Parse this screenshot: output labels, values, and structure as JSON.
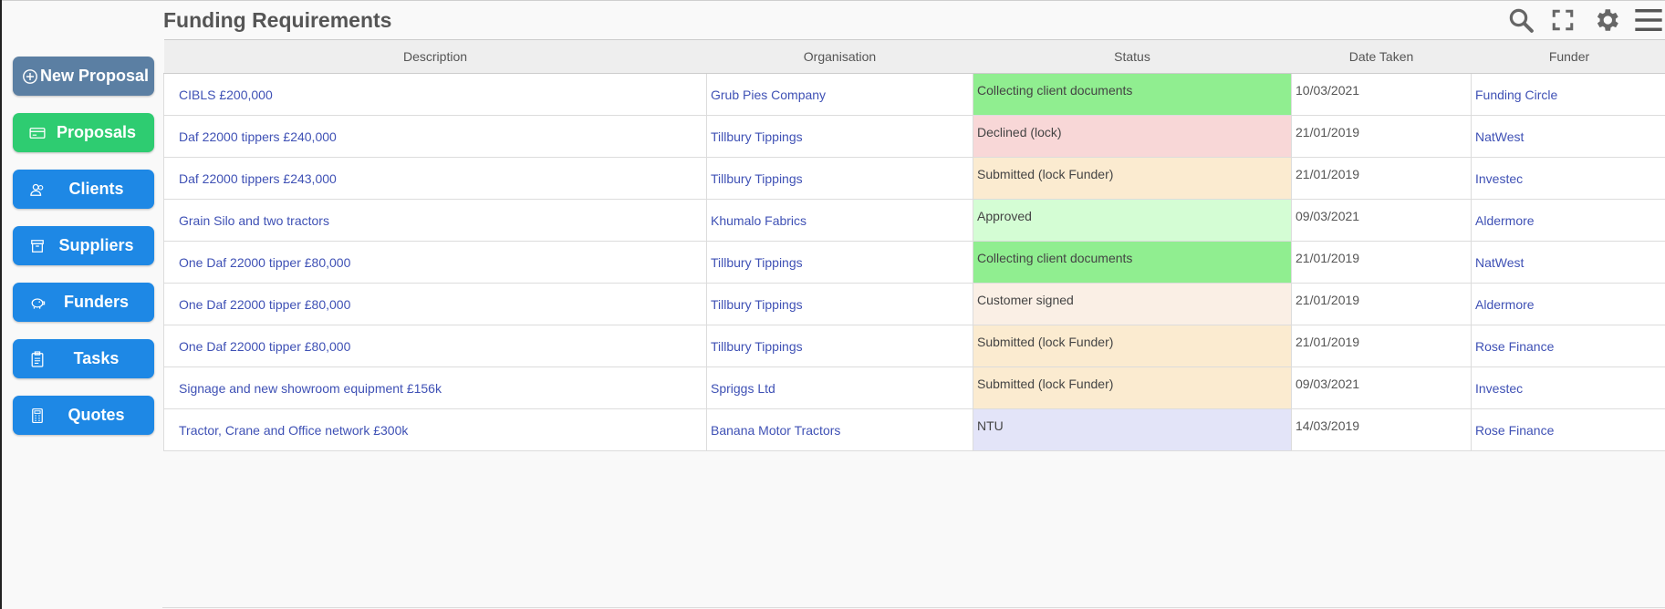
{
  "header": {
    "title": "Funding Requirements"
  },
  "toolbar": {
    "icons": [
      "search-icon",
      "fullscreen-icon",
      "gear-icon",
      "menu-icon"
    ]
  },
  "sidebar": {
    "items": [
      {
        "label": "New Proposal",
        "icon": "plus-circle-icon"
      },
      {
        "label": "Proposals",
        "icon": "card-icon"
      },
      {
        "label": "Clients",
        "icon": "users-icon"
      },
      {
        "label": "Suppliers",
        "icon": "box-icon"
      },
      {
        "label": "Funders",
        "icon": "piggy-bank-icon"
      },
      {
        "label": "Tasks",
        "icon": "clipboard-icon"
      },
      {
        "label": "Quotes",
        "icon": "calculator-icon"
      }
    ]
  },
  "table": {
    "columns": [
      "Description",
      "Organisation",
      "Status",
      "Date Taken",
      "Funder"
    ],
    "rows": [
      {
        "description": "CIBLS £200,000",
        "organisation": "Grub Pies Company",
        "status": "Collecting client documents",
        "status_color": "#90ee90",
        "date": "10/03/2021",
        "funder": "Funding Circle"
      },
      {
        "description": "Daf 22000 tippers £240,000",
        "organisation": "Tillbury Tippings",
        "status": "Declined (lock)",
        "status_color": "#f8d7d7",
        "date": "21/01/2019",
        "funder": "NatWest"
      },
      {
        "description": "Daf 22000 tippers £243,000",
        "organisation": "Tillbury Tippings",
        "status": "Submitted (lock Funder)",
        "status_color": "#fbebd0",
        "date": "21/01/2019",
        "funder": "Investec"
      },
      {
        "description": "Grain Silo and two tractors",
        "organisation": "Khumalo Fabrics",
        "status": "Approved",
        "status_color": "#d4fdd4",
        "date": "09/03/2021",
        "funder": "Aldermore"
      },
      {
        "description": "One Daf 22000 tipper £80,000",
        "organisation": "Tillbury Tippings",
        "status": "Collecting client documents",
        "status_color": "#90ee90",
        "date": "21/01/2019",
        "funder": "NatWest"
      },
      {
        "description": "One Daf 22000 tipper £80,000",
        "organisation": "Tillbury Tippings",
        "status": "Customer signed",
        "status_color": "#faefe5",
        "date": "21/01/2019",
        "funder": "Aldermore"
      },
      {
        "description": "One Daf 22000 tipper £80,000",
        "organisation": "Tillbury Tippings",
        "status": "Submitted (lock Funder)",
        "status_color": "#fbebd0",
        "date": "21/01/2019",
        "funder": "Rose Finance"
      },
      {
        "description": "Signage and new showroom equipment £156k",
        "organisation": "Spriggs Ltd",
        "status": "Submitted (lock Funder)",
        "status_color": "#fbebd0",
        "date": "09/03/2021",
        "funder": "Investec"
      },
      {
        "description": "Tractor, Crane and Office network £300k",
        "organisation": "Banana Motor Tractors",
        "status": "NTU",
        "status_color": "#e3e4f8",
        "date": "14/03/2019",
        "funder": "Rose Finance"
      }
    ]
  }
}
